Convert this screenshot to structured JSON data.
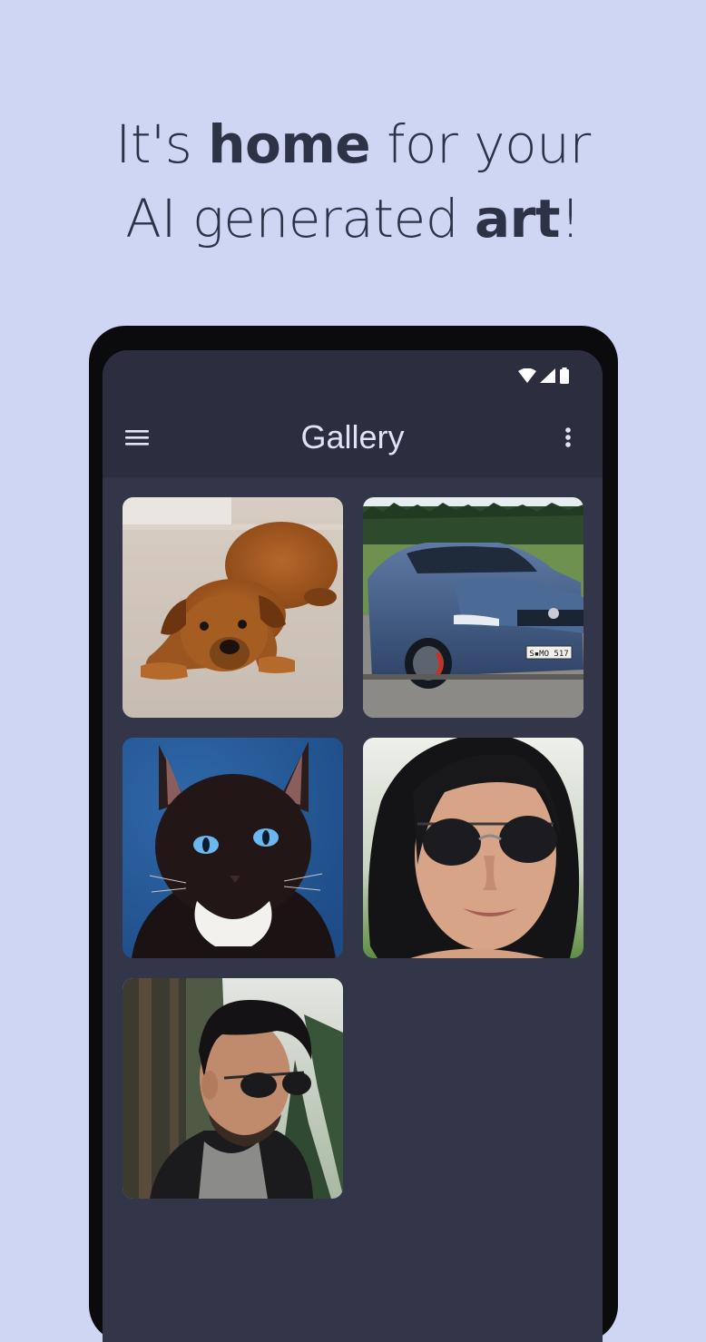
{
  "headline": {
    "line1_pre": "It's ",
    "line1_bold": "home",
    "line1_post": " for your",
    "line2_pre": "AI generated ",
    "line2_bold": "art",
    "line2_post": "!"
  },
  "status_bar": {
    "icons": [
      "wifi-icon",
      "cell-signal-icon",
      "battery-icon"
    ]
  },
  "app_bar": {
    "title": "Gallery",
    "left_icon": "menu-icon",
    "right_icon": "more-vert-icon"
  },
  "gallery": {
    "images": [
      {
        "name": "dog",
        "plate_text": ""
      },
      {
        "name": "car",
        "plate_text": "S▪MO 517"
      },
      {
        "name": "cat",
        "plate_text": ""
      },
      {
        "name": "woman",
        "plate_text": ""
      },
      {
        "name": "man",
        "plate_text": ""
      }
    ]
  },
  "colors": {
    "page_background": "#cfd6f4",
    "screen_background": "#333548",
    "app_bar_background": "#2c2e40",
    "title_text": "#dfe2f7",
    "headline_text": "#2e3246"
  }
}
